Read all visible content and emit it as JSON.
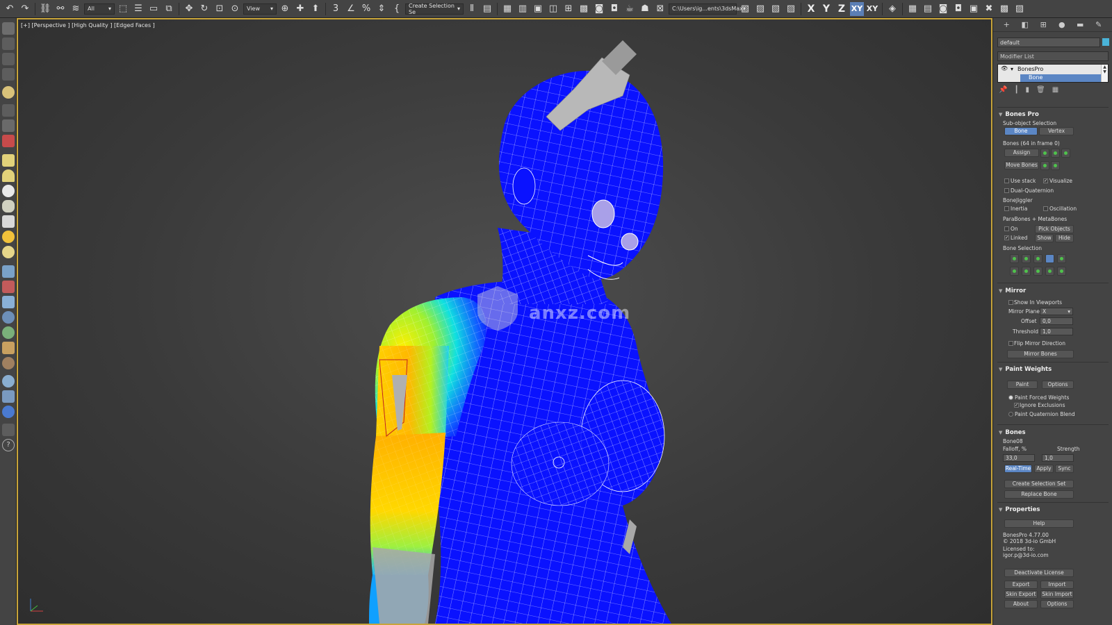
{
  "toolbar": {
    "selection_filter": "All",
    "view_dropdown": "View",
    "create_selection_set": "Create Selection Se",
    "project_path": "C:\\Users\\ig...ents\\3dsMax",
    "axis_x": "X",
    "axis_y": "Y",
    "axis_z": "Z",
    "axis_xy": "XY",
    "axis_xy2": "XY"
  },
  "viewport": {
    "label": "[+] [Perspective ] [High Quality ] [Edged Faces ]",
    "watermark_text": "anxz.com"
  },
  "panel": {
    "object_name": "default",
    "modifier_list": "Modifier List",
    "stack_items": [
      "BonesPro",
      "Bone"
    ],
    "rollouts": {
      "bones_pro": {
        "title": "Bones Pro",
        "subobject_label": "Sub-object Selection",
        "bone_btn": "Bone",
        "vertex_btn": "Vertex",
        "bones_count": "Bones (64 in frame 0)",
        "assign_btn": "Assign",
        "move_bones_btn": "Move Bones",
        "use_stack": "Use stack",
        "visualize": "Visualize",
        "dual_quaternion": "Dual-Quaternion",
        "bonejiggler": "BoneJiggler",
        "inertia": "Inertia",
        "oscillation": "Oscillation",
        "parabones": "ParaBones + MetaBones",
        "on": "On",
        "pick_objects": "Pick Objects",
        "linked": "Linked",
        "show": "Show",
        "hide": "Hide",
        "bone_selection": "Bone Selection"
      },
      "mirror": {
        "title": "Mirror",
        "show_in_viewports": "Show In Viewports",
        "mirror_plane_label": "Mirror Plane",
        "mirror_plane_value": "X",
        "offset_label": "Offset",
        "offset_value": "0,0",
        "threshold_label": "Threshold",
        "threshold_value": "1,0",
        "flip_mirror": "Flip Mirror Direction",
        "mirror_bones_btn": "Mirror Bones"
      },
      "paint_weights": {
        "title": "Paint Weights",
        "paint_btn": "Paint",
        "options_btn": "Options",
        "paint_forced": "Paint Forced Weights",
        "ignore_exclusions": "Ignore Exclusions",
        "paint_quaternion": "Paint Quaternion Blend"
      },
      "bones": {
        "title": "Bones",
        "current_bone": "Bone08",
        "falloff_label": "Falloff, %",
        "strength_label": "Strength",
        "falloff_value": "33,0",
        "strength_value": "1,0",
        "realtime_btn": "Real-Time",
        "apply_btn": "Apply",
        "sync_btn": "Sync",
        "create_selection_set_btn": "Create Selection Set",
        "replace_bone_btn": "Replace Bone"
      },
      "properties": {
        "title": "Properties",
        "help_btn": "Help",
        "version": "BonesPro 4.77.00",
        "copyright": "© 2018 3d-io GmbH",
        "licensed_to": "Licensed to:",
        "licensee": "igor.p@3d-io.com",
        "deactivate_btn": "Deactivate License",
        "export_btn": "Export",
        "import_btn": "Import",
        "skin_export_btn": "Skin Export",
        "skin_import_btn": "Skin Import",
        "about_btn": "About",
        "options_btn": "Options"
      }
    }
  },
  "colors": {
    "mesh_blue": "#0a12ff",
    "viewport_border": "#c9a53a",
    "accent": "#5b86c4"
  }
}
